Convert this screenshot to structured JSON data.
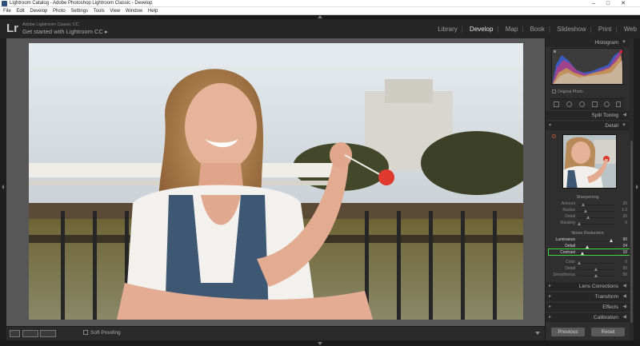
{
  "window": {
    "title": "Lightroom Catalog - Adobe Photoshop Lightroom Classic - Develop",
    "controls": "–□✕"
  },
  "menu": [
    "File",
    "Edit",
    "Develop",
    "Photo",
    "Settings",
    "Tools",
    "View",
    "Window",
    "Help"
  ],
  "identity": {
    "logo": "Lr",
    "product": "Adobe Lightroom Classic CC",
    "message": "Get started with Lightroom CC ▸"
  },
  "modules": {
    "library": "Library",
    "develop": "Develop",
    "map": "Map",
    "book": "Book",
    "slideshow": "Slideshow",
    "print": "Print",
    "web": "Web",
    "separator": "|"
  },
  "toolbar": {
    "soft_proofing": "Soft Proofing"
  },
  "panels": {
    "histogram": "Histogram",
    "original_photo": "Original Photo",
    "split_toning": "Split Toning",
    "detail": "Detail",
    "sharpening": {
      "title": "Sharpening",
      "rows": [
        {
          "label": "Amount",
          "value": "25"
        },
        {
          "label": "Radius",
          "value": "1.0"
        },
        {
          "label": "Detail",
          "value": "25"
        },
        {
          "label": "Masking",
          "value": "0"
        }
      ]
    },
    "noise_reduction": {
      "title": "Noise Reduction",
      "rows": [
        {
          "label": "Luminance",
          "value": "90"
        },
        {
          "label": "Detail",
          "value": "24"
        },
        {
          "label": "Contrast",
          "value": "10"
        },
        {
          "label": "Color",
          "value": "0"
        },
        {
          "label": "Detail",
          "value": "50"
        },
        {
          "label": "Smoothness",
          "value": "50"
        }
      ]
    },
    "lens_corrections": "Lens Corrections",
    "transform": "Transform",
    "effects": "Effects",
    "calibration": "Calibration"
  },
  "buttons": {
    "previous": "Previous",
    "reset": "Reset"
  },
  "colors": {
    "highlight": "#3fd33f",
    "active_module": "#e6e6e6"
  }
}
